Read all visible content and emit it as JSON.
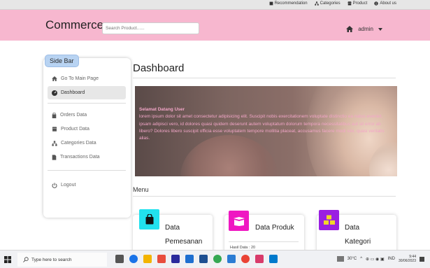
{
  "topbar": {
    "links": [
      {
        "label": "Recommendation",
        "icon": "book-icon"
      },
      {
        "label": "Categories",
        "icon": "sitemap-icon"
      },
      {
        "label": "Product",
        "icon": "store-icon"
      },
      {
        "label": "About us",
        "icon": "info-icon"
      }
    ]
  },
  "navbar": {
    "brand": "Commerce",
    "search_placeholder": "Search Product......",
    "user": "admin",
    "bg_color": "#f7b7cf"
  },
  "sidebar": {
    "title": "Side Bar",
    "items": [
      {
        "label": "Go To Main Page",
        "icon": "home-icon"
      },
      {
        "label": "Dashboard",
        "icon": "gauge-icon",
        "active": true
      },
      {
        "label": "Orders Data",
        "icon": "bag-icon"
      },
      {
        "label": "Product Data",
        "icon": "store-icon"
      },
      {
        "label": "Categories Data",
        "icon": "sitemap-icon"
      },
      {
        "label": "Transactions Data",
        "icon": "file-icon"
      },
      {
        "label": "Logout",
        "icon": "power-icon"
      }
    ]
  },
  "main": {
    "title": "Dashboard",
    "hero": {
      "heading": "Selamat Datang User",
      "text": "lorem ipsum dolor sit amet consectetur adipisicing elit. Suscipit nobis exercitationem voluptate distinctio ea natus eveniet, ipsam adipisci vero, id dolores quasi quidem deserunt autem voluptatum dolorum tempora necessitatibus aut sit error ab libero? Dolores libero suscipit officia esse voluptatem tempore mollitia placeat, accusamus facere modi iste, quasi veritatis alias.",
      "text_color": "#f3a6c8"
    },
    "menu_label": "Menu",
    "cards": [
      {
        "title_line1": "Data",
        "title_line2": "Pemesanan",
        "icon": "shopping-bag-icon",
        "color": "#21e1ee"
      },
      {
        "title_line1": "Data Produk",
        "sub": "Hasil Data : 20",
        "icon": "box-open-icon",
        "color": "#ef18c2"
      },
      {
        "title_line1": "Data",
        "title_line2": "Kategori",
        "icon": "boxes-icon",
        "color": "#9a1fe2"
      }
    ]
  },
  "taskbar": {
    "search_placeholder": "Type here to search",
    "weather": "30°C",
    "lang": "IND",
    "time": "9:44",
    "date": "30/06/2023"
  }
}
